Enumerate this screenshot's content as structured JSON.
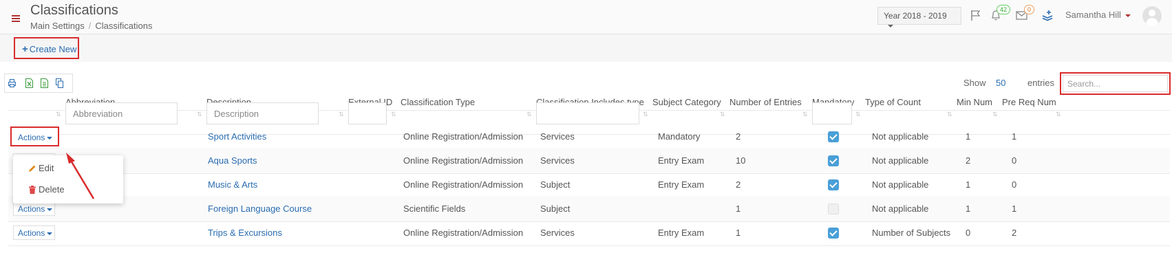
{
  "header": {
    "title": "Classifications",
    "breadcrumb": [
      "Main Settings",
      "Classifications"
    ],
    "year_selector": "Year 2018 - 2019",
    "notifications_count": "42",
    "messages_count": "0",
    "user_name": "Samantha Hill"
  },
  "toolbar": {
    "create_label": "Create New",
    "show_label": "Show",
    "page_size": "50",
    "entries_label": "entries",
    "search_placeholder": "Search..."
  },
  "table": {
    "columns": [
      "Abbreviation",
      "Description",
      "External ID",
      "Classification Type",
      "Classification Includes type",
      "Subject Category",
      "Number of Entries",
      "Mandatory",
      "Type of Count",
      "Min Num",
      "Pre Req Num"
    ],
    "filters": {
      "abbreviation_placeholder": "Abbreviation",
      "description_placeholder": "Description"
    },
    "actions_label": "Actions",
    "rows": [
      {
        "description": "Sport Activities",
        "type": "Online Registration/Admission",
        "includes": "Services",
        "category": "Mandatory",
        "entries": "2",
        "mandatory": true,
        "count_type": "Not applicable",
        "min": "1",
        "prereq": "1"
      },
      {
        "description": "Aqua Sports",
        "type": "Online Registration/Admission",
        "includes": "Services",
        "category": "Entry Exam",
        "entries": "10",
        "mandatory": true,
        "count_type": "Not applicable",
        "min": "2",
        "prereq": "0"
      },
      {
        "description": "Music & Arts",
        "type": "Online Registration/Admission",
        "includes": "Subject",
        "category": "Entry Exam",
        "entries": "2",
        "mandatory": true,
        "count_type": "Not applicable",
        "min": "1",
        "prereq": "0"
      },
      {
        "description": "Foreign Language Course",
        "type": "Scientific Fields",
        "includes": "Subject",
        "category": "",
        "entries": "1",
        "mandatory": false,
        "count_type": "Not applicable",
        "min": "1",
        "prereq": "1"
      },
      {
        "description": "Trips & Excursions",
        "type": "Online Registration/Admission",
        "includes": "Services",
        "category": "Entry Exam",
        "entries": "1",
        "mandatory": true,
        "count_type": "Number of Subjects",
        "min": "0",
        "prereq": "2"
      }
    ]
  },
  "dropdown": {
    "edit_label": "Edit",
    "delete_label": "Delete"
  },
  "colors": {
    "link": "#2a6cb0",
    "highlight": "#d92b2b",
    "checkbox": "#4a9fd8"
  }
}
